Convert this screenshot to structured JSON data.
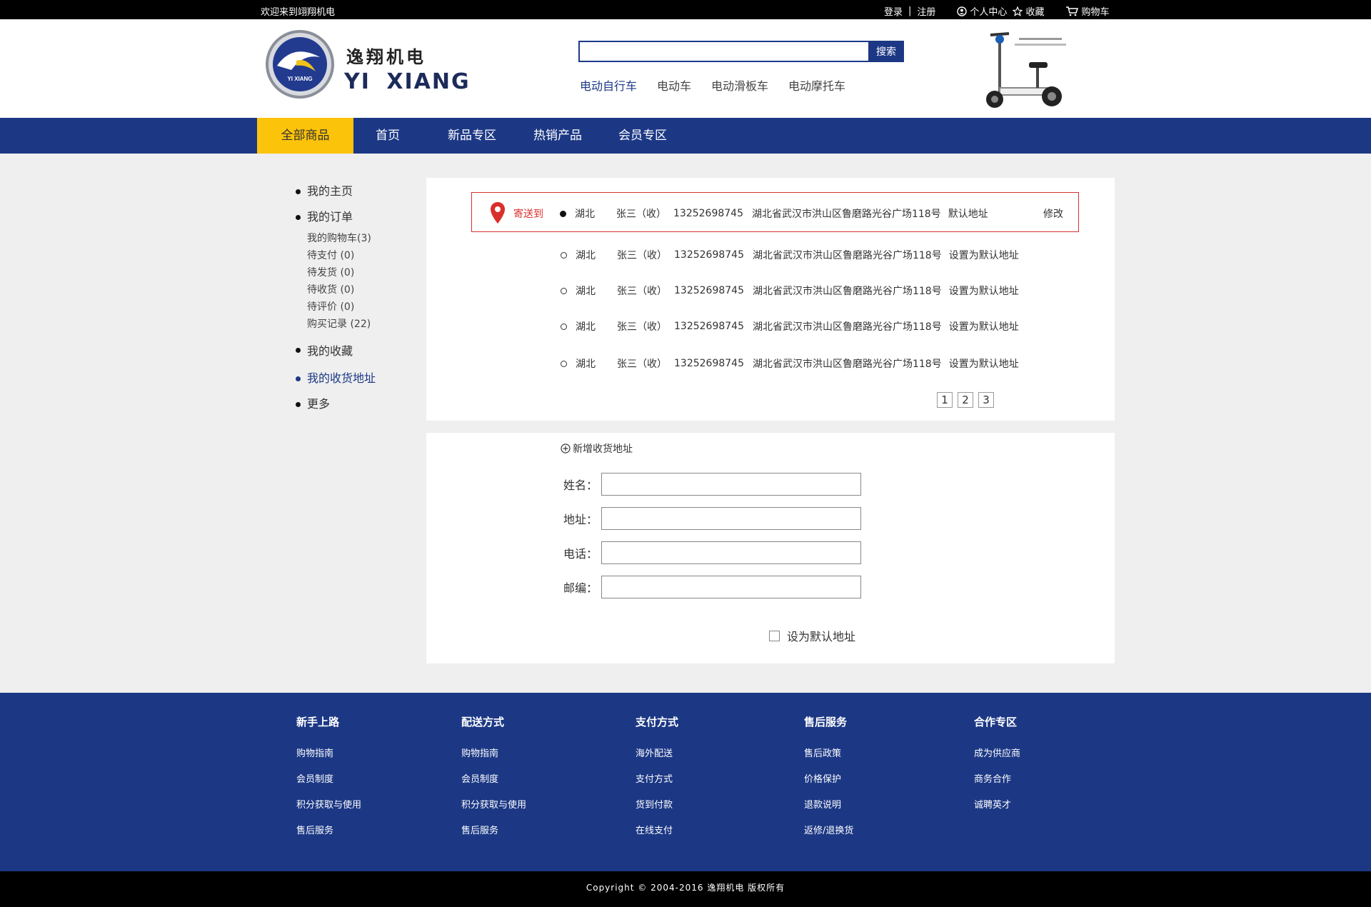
{
  "topbar": {
    "welcome": "欢迎来到翊翔机电",
    "login": "登录",
    "sep": "|",
    "register": "注册",
    "user_center": "个人中心",
    "favorites": "收藏",
    "cart": "购物车"
  },
  "header": {
    "brand_cn": "逸翔机电",
    "brand_en": "YI XIANG",
    "logo_text": "YI XIANG",
    "search_placeholder": "",
    "search_button": "搜索",
    "hot_links": [
      "电动自行车",
      "电动车",
      "电动滑板车",
      "电动摩托车"
    ]
  },
  "nav": {
    "items": [
      "全部商品",
      "首页",
      "新品专区",
      "热销产品",
      "会员专区"
    ]
  },
  "sidebar": {
    "home": "我的主页",
    "orders": "我的订单",
    "sub": [
      "我的购物车(3)",
      "待支付 (0)",
      "待发货 (0)",
      "待收货 (0)",
      "待评价 (0)",
      "购买记录 (22)"
    ],
    "favorites": "我的收藏",
    "addresses": "我的收货地址",
    "more": "更多"
  },
  "addresses": {
    "send_to": "寄送到",
    "modify": "修改",
    "list": [
      {
        "province": "湖北",
        "name": "张三（收）",
        "phone": "13252698745",
        "detail": "湖北省武汉市洪山区鲁磨路光谷广场118号",
        "action": "默认地址"
      },
      {
        "province": "湖北",
        "name": "张三（收）",
        "phone": "13252698745",
        "detail": "湖北省武汉市洪山区鲁磨路光谷广场118号",
        "action": "设置为默认地址"
      },
      {
        "province": "湖北",
        "name": "张三（收）",
        "phone": "13252698745",
        "detail": "湖北省武汉市洪山区鲁磨路光谷广场118号",
        "action": "设置为默认地址"
      },
      {
        "province": "湖北",
        "name": "张三（收）",
        "phone": "13252698745",
        "detail": "湖北省武汉市洪山区鲁磨路光谷广场118号",
        "action": "设置为默认地址"
      },
      {
        "province": "湖北",
        "name": "张三（收）",
        "phone": "13252698745",
        "detail": "湖北省武汉市洪山区鲁磨路光谷广场118号",
        "action": "设置为默认地址"
      }
    ],
    "pages": [
      "1",
      "2",
      "3"
    ]
  },
  "form": {
    "title": "新增收货地址",
    "name_label": "姓名：",
    "address_label": "地址：",
    "phone_label": "电话：",
    "zip_label": "邮编：",
    "default_label": "设为默认地址"
  },
  "footer": {
    "columns": [
      {
        "title": "新手上路",
        "links": [
          "购物指南",
          "会员制度",
          "积分获取与使用",
          "售后服务"
        ]
      },
      {
        "title": "配送方式",
        "links": [
          "购物指南",
          "会员制度",
          "积分获取与使用",
          "售后服务"
        ]
      },
      {
        "title": "支付方式",
        "links": [
          "海外配送",
          "支付方式",
          "货到付款",
          "在线支付"
        ]
      },
      {
        "title": "售后服务",
        "links": [
          "售后政策",
          "价格保护",
          "退款说明",
          "返修/退换货"
        ]
      },
      {
        "title": "合作专区",
        "links": [
          "成为供应商",
          "商务合作",
          "诚聘英才"
        ]
      }
    ],
    "copyright": "Copyright © 2004-2016  逸翔机电 版权所有"
  },
  "colors": {
    "primary": "#1c3885",
    "accent": "#fcc30b",
    "alert": "#d9302c"
  }
}
